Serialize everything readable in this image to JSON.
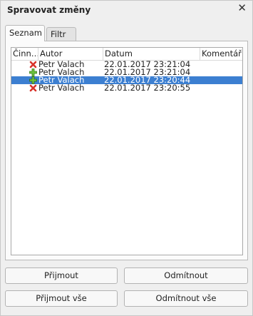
{
  "dialog": {
    "title": "Spravovat změny"
  },
  "tabs": [
    {
      "label": "Seznam",
      "active": true
    },
    {
      "label": "Filtr",
      "active": false
    }
  ],
  "columns": [
    "Činnost",
    "Autor",
    "Datum",
    "Komentář"
  ],
  "header_visible": [
    "Činn…",
    "Autor",
    "Datum",
    "Komentář"
  ],
  "rows": [
    {
      "action": "reject-icon",
      "author": "Petr Valach",
      "date": "22.01.2017 23:21:04",
      "selected": false
    },
    {
      "action": "insert-icon",
      "author": "Petr Valach",
      "date": "22.01.2017 23:21:04",
      "selected": false
    },
    {
      "action": "insert-icon",
      "author": "Petr Valach",
      "date": "22.01.2017 23:20:44",
      "selected": true
    },
    {
      "action": "reject-icon",
      "author": "Petr Valach",
      "date": "22.01.2017 23:20:55",
      "selected": false
    }
  ],
  "buttons": {
    "accept": "Přijmout",
    "reject": "Odmítnout",
    "accept_all": "Přijmout vše",
    "reject_all": "Odmítnout vše"
  },
  "colors": {
    "selection": "#3c7fd1",
    "delete_red": "#d8322a",
    "insert_green": "#4fae2a"
  }
}
